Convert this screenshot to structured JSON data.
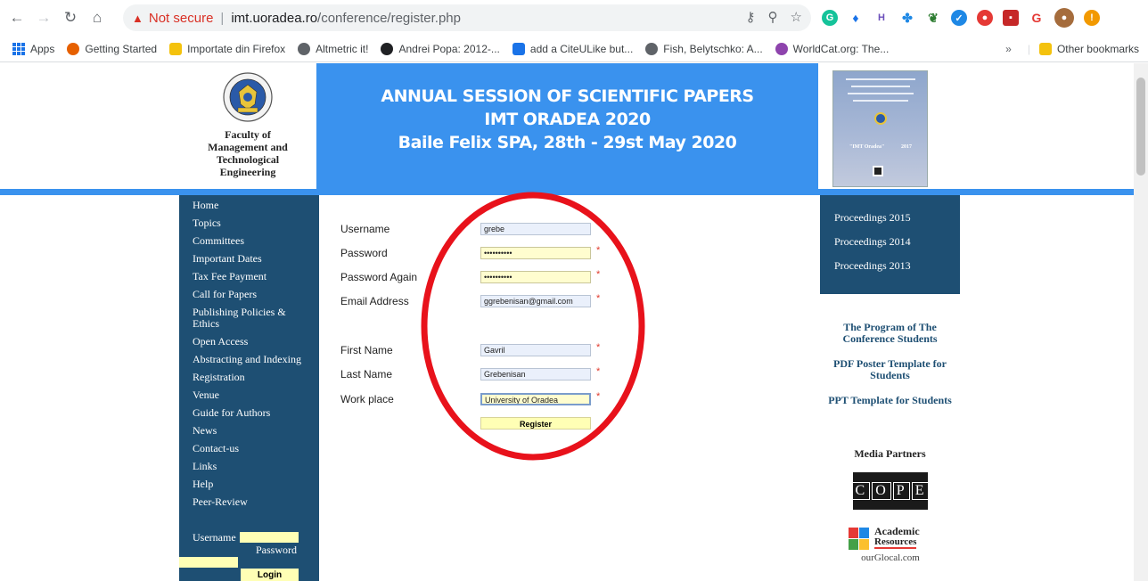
{
  "browser": {
    "security_label": "Not secure",
    "url_host": "imt.uoradea.ro",
    "url_path": "/conference/register.php",
    "extensions": [
      "grammarly-icon",
      "shield-icon",
      "h-icon",
      "puzzle-icon",
      "leaf-icon",
      "circle-check-icon",
      "shield-red-icon",
      "badge-icon",
      "g-icon",
      "profile-icon",
      "alert-icon"
    ],
    "bookmarks": [
      {
        "label": "Apps",
        "icon": "apps-grid-icon"
      },
      {
        "label": "Getting Started",
        "icon": "firefox-icon",
        "color": "#e66000"
      },
      {
        "label": "Importate din Firefox",
        "icon": "folder-icon",
        "color": "#f4c20d"
      },
      {
        "label": "Altmetric it!",
        "icon": "globe-icon",
        "color": "#5f6368"
      },
      {
        "label": "Andrei Popa: 2012-...",
        "icon": "dark-circle-icon",
        "color": "#202124"
      },
      {
        "label": "add a CiteULike but...",
        "icon": "doc-icon",
        "color": "#1a73e8"
      },
      {
        "label": "Fish, Belytschko: A...",
        "icon": "globe-icon",
        "color": "#5f6368"
      },
      {
        "label": "WorldCat.org: The...",
        "icon": "worldcat-icon",
        "color": "#8e44ad"
      }
    ],
    "more_bookmarks": "»",
    "other_bookmarks": "Other bookmarks"
  },
  "header": {
    "faculty_line1": "Faculty of",
    "faculty_line2": "Management and",
    "faculty_line3": "Technological",
    "faculty_line4": "Engineering",
    "banner_line1": "ANNUAL SESSION OF SCIENTIFIC PAPERS",
    "banner_line2": "IMT ORADEA 2020",
    "banner_line3": "Baile Felix SPA, 28th - 29st May 2020"
  },
  "sidebar": {
    "items": [
      {
        "label": "Home"
      },
      {
        "label": "Topics"
      },
      {
        "label": "Committees"
      },
      {
        "label": "Important Dates"
      },
      {
        "label": "Tax Fee Payment"
      },
      {
        "label": "Call for Papers"
      },
      {
        "label": "Publishing Policies & Ethics"
      },
      {
        "label": "Open Access"
      },
      {
        "label": "Abstracting and Indexing"
      },
      {
        "label": "Registration"
      },
      {
        "label": "Venue"
      },
      {
        "label": "Guide for Authors"
      },
      {
        "label": "News"
      },
      {
        "label": "Contact-us"
      },
      {
        "label": "Links"
      },
      {
        "label": "Help"
      },
      {
        "label": "Peer-Review"
      }
    ],
    "login": {
      "username_label": "Username",
      "password_label": "Password",
      "login_button": "Login"
    }
  },
  "form": {
    "username_label": "Username",
    "username_value": "grebe",
    "password_label": "Password",
    "password_value": "••••••••••",
    "password_again_label": "Password Again",
    "password_again_value": "••••••••••",
    "email_label": "Email Address",
    "email_value": "ggrebenisan@gmail.com",
    "first_name_label": "First Name",
    "first_name_value": "Gavril",
    "last_name_label": "Last Name",
    "last_name_value": "Grebenisan",
    "work_place_label": "Work place",
    "work_place_value": "University of Oradea",
    "required_mark": "*",
    "register_button": "Register"
  },
  "right": {
    "proceedings": [
      "Proceedings 2015",
      "Proceedings 2014",
      "Proceedings 2013"
    ],
    "program_link": "The Program of The Conference Students",
    "poster_link": "PDF Poster Template for Students",
    "ppt_link": "PPT Template for Students",
    "media_partners": "Media Partners",
    "cope_letters": [
      "C",
      "O",
      "P",
      "E"
    ],
    "academic_line1": "Academic",
    "academic_line2": "Resources",
    "academic_line3": "ourGlocal.com"
  },
  "cover": {
    "title_text": "\"IMT Oradea\"",
    "year_text": "2017"
  },
  "colors": {
    "banner_blue": "#3a92ee",
    "sidebar_navy": "#1e4f73",
    "field_yellow": "#ffffb5",
    "highlight_red": "#e8121b"
  }
}
